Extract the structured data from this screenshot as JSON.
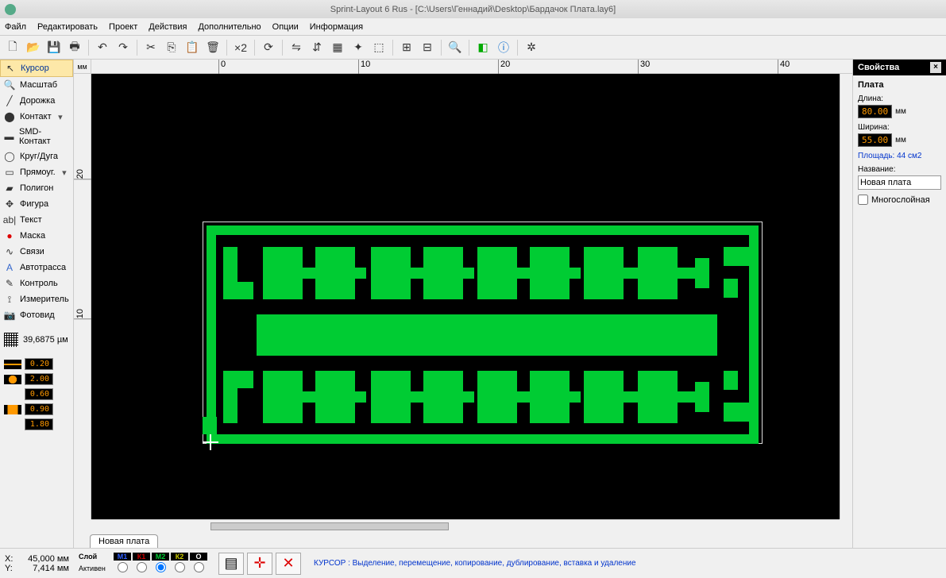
{
  "title": "Sprint-Layout 6 Rus - [C:\\Users\\Геннадий\\Desktop\\Бардачок Плата.lay6]",
  "menu": [
    "Файл",
    "Редактировать",
    "Проект",
    "Действия",
    "Дополнительно",
    "Опции",
    "Информация"
  ],
  "tools": [
    {
      "icon": "↖",
      "label": "Курсор",
      "sel": true,
      "dd": false
    },
    {
      "icon": "🔍",
      "label": "Масштаб",
      "dd": false
    },
    {
      "icon": "╱",
      "label": "Дорожка",
      "dd": false
    },
    {
      "icon": "⬤",
      "label": "Контакт",
      "dd": true
    },
    {
      "icon": "▬",
      "label": "SMD-Контакт",
      "dd": false
    },
    {
      "icon": "◯",
      "label": "Круг/Дуга",
      "dd": false
    },
    {
      "icon": "▭",
      "label": "Прямоуг.",
      "dd": true
    },
    {
      "icon": "▰",
      "label": "Полигон",
      "dd": false
    },
    {
      "icon": "✥",
      "label": "Фигура",
      "dd": false
    },
    {
      "icon": "ab|",
      "label": "Текст",
      "dd": false
    },
    {
      "icon": "●",
      "label": "Маска",
      "dd": false,
      "color": "#d00"
    },
    {
      "icon": "∿",
      "label": "Связи",
      "dd": false
    },
    {
      "icon": "A",
      "label": "Автотрасса",
      "dd": false,
      "color": "#36c"
    },
    {
      "icon": "✎",
      "label": "Контроль",
      "dd": false
    },
    {
      "icon": "⟟",
      "label": "Измеритель",
      "dd": false
    },
    {
      "icon": "📷",
      "label": "Фотовид",
      "dd": false
    }
  ],
  "grid": "39,6875 µм",
  "params": [
    {
      "v": "0.20"
    },
    {
      "v": "2.00"
    },
    {
      "v": "0.60"
    },
    {
      "v": "0.90"
    },
    {
      "v": "1.80"
    }
  ],
  "ruler_unit": "мм",
  "hticks": [
    0,
    10,
    20,
    30,
    40
  ],
  "vticks": [
    "20",
    "10"
  ],
  "tab": "Новая плата",
  "props": {
    "title": "Свойства",
    "section": "Плата",
    "length_lbl": "Длина:",
    "length": "80.00",
    "unit": "мм",
    "width_lbl": "Ширина:",
    "width": "55.00",
    "area": "Площадь: 44 см2",
    "name_lbl": "Название:",
    "name": "Новая плата",
    "multi": "Многослойная"
  },
  "status": {
    "x_lbl": "X:",
    "x": "45,000 мм",
    "y_lbl": "Y:",
    "y": "7,414 мм",
    "layer_lbl": "Слой",
    "active": "Активен",
    "layers": [
      {
        "n": "М1",
        "c": "#3060ff"
      },
      {
        "n": "К1",
        "c": "#cc0000"
      },
      {
        "n": "М2",
        "c": "#00cc33"
      },
      {
        "n": "К2",
        "c": "#cccc00"
      },
      {
        "n": "О",
        "c": "#ffffff"
      }
    ],
    "hint": "КУРСОР  : Выделение, перемещение, копирование, дублирование, вставка и удаление"
  },
  "chart_data": {
    "type": "table",
    "title": "PCB board dimensions",
    "categories": [
      "Длина (мм)",
      "Ширина (мм)",
      "Площадь (см2)"
    ],
    "values": [
      80.0,
      55.0,
      44
    ]
  }
}
